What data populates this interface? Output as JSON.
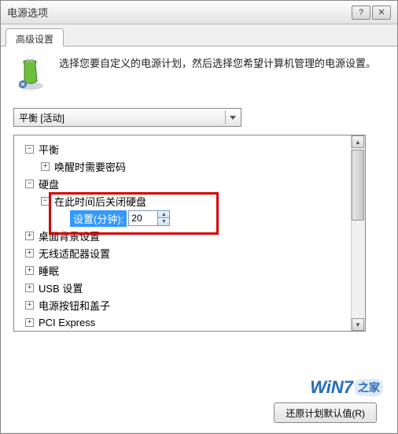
{
  "window": {
    "title": "电源选项"
  },
  "tabs": {
    "advanced": "高级设置"
  },
  "info": {
    "text": "选择您要自定义的电源计划，然后选择您希望计算机管理的电源设置。"
  },
  "plan_dropdown": {
    "selected": "平衡 [活动]"
  },
  "tree": {
    "balance": {
      "label": "平衡",
      "expanded": true
    },
    "wake_password": {
      "label": "唤醒时需要密码",
      "expanded": false
    },
    "hard_disk": {
      "label": "硬盘",
      "expanded": true
    },
    "turn_off_disk": {
      "label": "在此时间后关闭硬盘",
      "expanded": true
    },
    "setting_label": "设置(分钟):",
    "setting_value": "20",
    "desktop_bg": {
      "label": "桌面背景设置",
      "expanded": false
    },
    "wireless": {
      "label": "无线适配器设置",
      "expanded": false
    },
    "sleep": {
      "label": "睡眠",
      "expanded": false
    },
    "usb": {
      "label": "USB 设置",
      "expanded": false
    },
    "power_buttons": {
      "label": "电源按钮和盖子",
      "expanded": false
    },
    "pci_express": {
      "label": "PCI Express",
      "expanded": false
    }
  },
  "buttons": {
    "restore_defaults": "还原计划默认值(R)"
  },
  "watermark": {
    "brand": "WiN7",
    "suffix": "之家"
  }
}
